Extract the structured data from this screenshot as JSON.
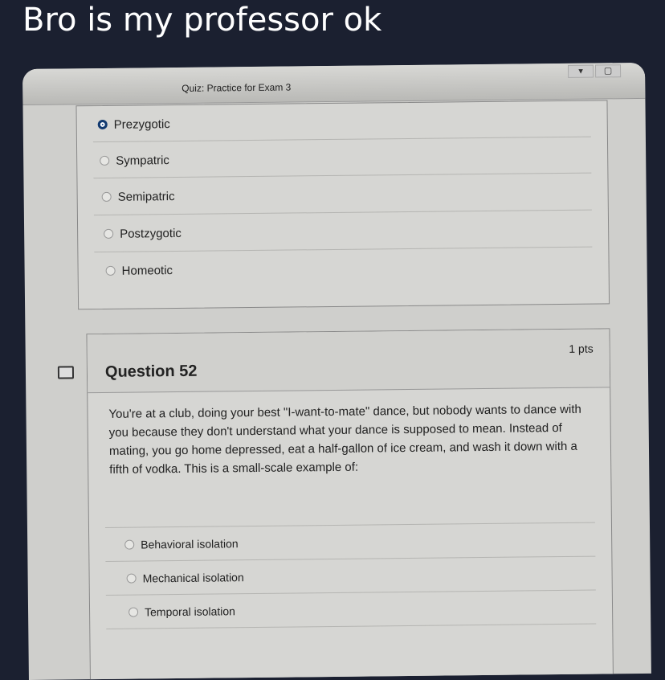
{
  "caption": "Bro is my professor ok",
  "quiz": {
    "title": "Quiz: Practice for Exam 3",
    "prev_options": [
      {
        "label": "Prezygotic",
        "selected": true
      },
      {
        "label": "Sympatric",
        "selected": false
      },
      {
        "label": "Semipatric",
        "selected": false
      },
      {
        "label": "Postzygotic",
        "selected": false
      },
      {
        "label": "Homeotic",
        "selected": false
      }
    ],
    "question": {
      "title": "Question 52",
      "points": "1 pts",
      "text": "You're at a club, doing your best \"I-want-to-mate\" dance, but nobody wants to dance with you because they don't understand what your dance is supposed to mean. Instead of mating, you go home depressed, eat a half-gallon of ice cream, and wash it down with a fifth of vodka. This is a small-scale example of:",
      "options": [
        "Behavioral isolation",
        "Mechanical isolation",
        "Temporal isolation"
      ]
    }
  },
  "colors": {
    "background": "#1b2030",
    "selected_radio": "#1f4f8f"
  }
}
